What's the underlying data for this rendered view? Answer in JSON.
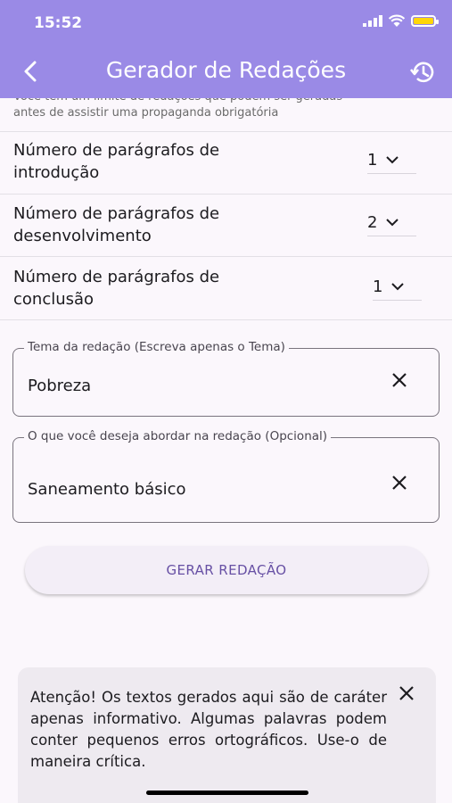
{
  "status_bar": {
    "time": "15:52"
  },
  "app_bar": {
    "title": "Gerador de Redações"
  },
  "note": {
    "line1": "Você tem um limite de redações que podem ser geradas",
    "line2": "antes de assistir uma propaganda obrigatória"
  },
  "paragraph_settings": [
    {
      "label": "Número de parágrafos de introdução",
      "value": "1"
    },
    {
      "label": "Número de parágrafos de desenvolvimento",
      "value": "2"
    },
    {
      "label": "Número de parágrafos de conclusão",
      "value": "1"
    }
  ],
  "theme_field": {
    "label": "Tema da redação (Escreva apenas o Tema)",
    "value": "Pobreza"
  },
  "topic_field": {
    "label": "O que você deseja abordar na redação (Opcional)",
    "value": "Saneamento básico"
  },
  "generate_button": {
    "label": "GERAR REDAÇÃO"
  },
  "warning": {
    "text": "Atenção! Os textos gerados aqui são de caráter apenas informativo. Algumas palavras podem conter pequenos erros ortográficos. Use-o de maneira crítica."
  },
  "colors": {
    "app_bar": "#9a8ae6",
    "accent": "#6750a4",
    "background": "#fbf7fc"
  }
}
